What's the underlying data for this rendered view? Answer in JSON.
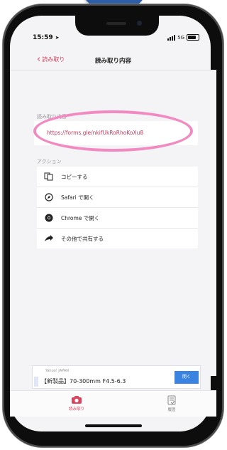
{
  "status_bar": {
    "time": "15:59",
    "network": "5G"
  },
  "nav": {
    "back_label": "読み取り",
    "title": "読み取り内容"
  },
  "content_section": {
    "header": "読み取り内容",
    "url": "https://forms.gle/nkifUkRoRhoKoXu8"
  },
  "actions_section": {
    "header": "アクション",
    "items": [
      {
        "label": "コピーする",
        "icon": "copy-icon"
      },
      {
        "label": "Safari で開く",
        "icon": "compass-icon"
      },
      {
        "label": "Chrome で開く",
        "icon": "chrome-icon"
      },
      {
        "label": "その他で共有する",
        "icon": "share-icon"
      }
    ]
  },
  "ad": {
    "source": "Yahoo! JAPAN",
    "text": "【新製品】70-300mm F4.5-6.3",
    "button_label": "開く"
  },
  "tab_bar": {
    "tabs": [
      {
        "label": "読み取り",
        "icon": "camera-icon"
      },
      {
        "label": "履歴",
        "icon": "history-icon"
      }
    ]
  },
  "colors": {
    "accent": "#d9455f",
    "annotation_ring": "#f28ac2",
    "annotation_arrow": "#2f5ea8",
    "ad_button": "#3b83e0"
  }
}
